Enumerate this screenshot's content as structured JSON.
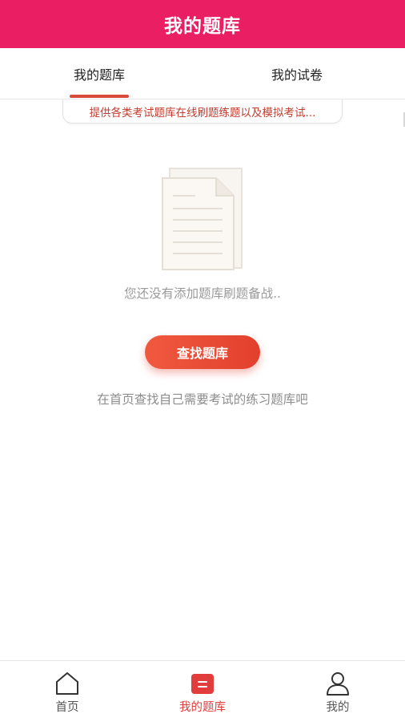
{
  "header": {
    "title": "我的题库"
  },
  "tabs": [
    {
      "label": "我的题库",
      "active": true
    },
    {
      "label": "我的试卷",
      "active": false
    }
  ],
  "notice": {
    "text": "提供各类考试题库在线刷题练题以及模拟考试..."
  },
  "empty_state": {
    "icon": "document-icon",
    "message": "您还没有添加题库刷题备战..",
    "button_label": "查找题库",
    "hint": "在首页查找自己需要考试的练习题库吧"
  },
  "bottom_nav": [
    {
      "label": "首页",
      "icon": "home-icon",
      "active": false
    },
    {
      "label": "我的题库",
      "icon": "question-bank-icon",
      "active": true
    },
    {
      "label": "我的",
      "icon": "user-icon",
      "active": false
    }
  ],
  "colors": {
    "header_bg": "#e91e63",
    "accent": "#e23d3d",
    "tab_indicator": "#d84b3a",
    "notice_text": "#c33b2e",
    "button_gradient_start": "#f0593f",
    "button_gradient_end": "#e2402d"
  }
}
